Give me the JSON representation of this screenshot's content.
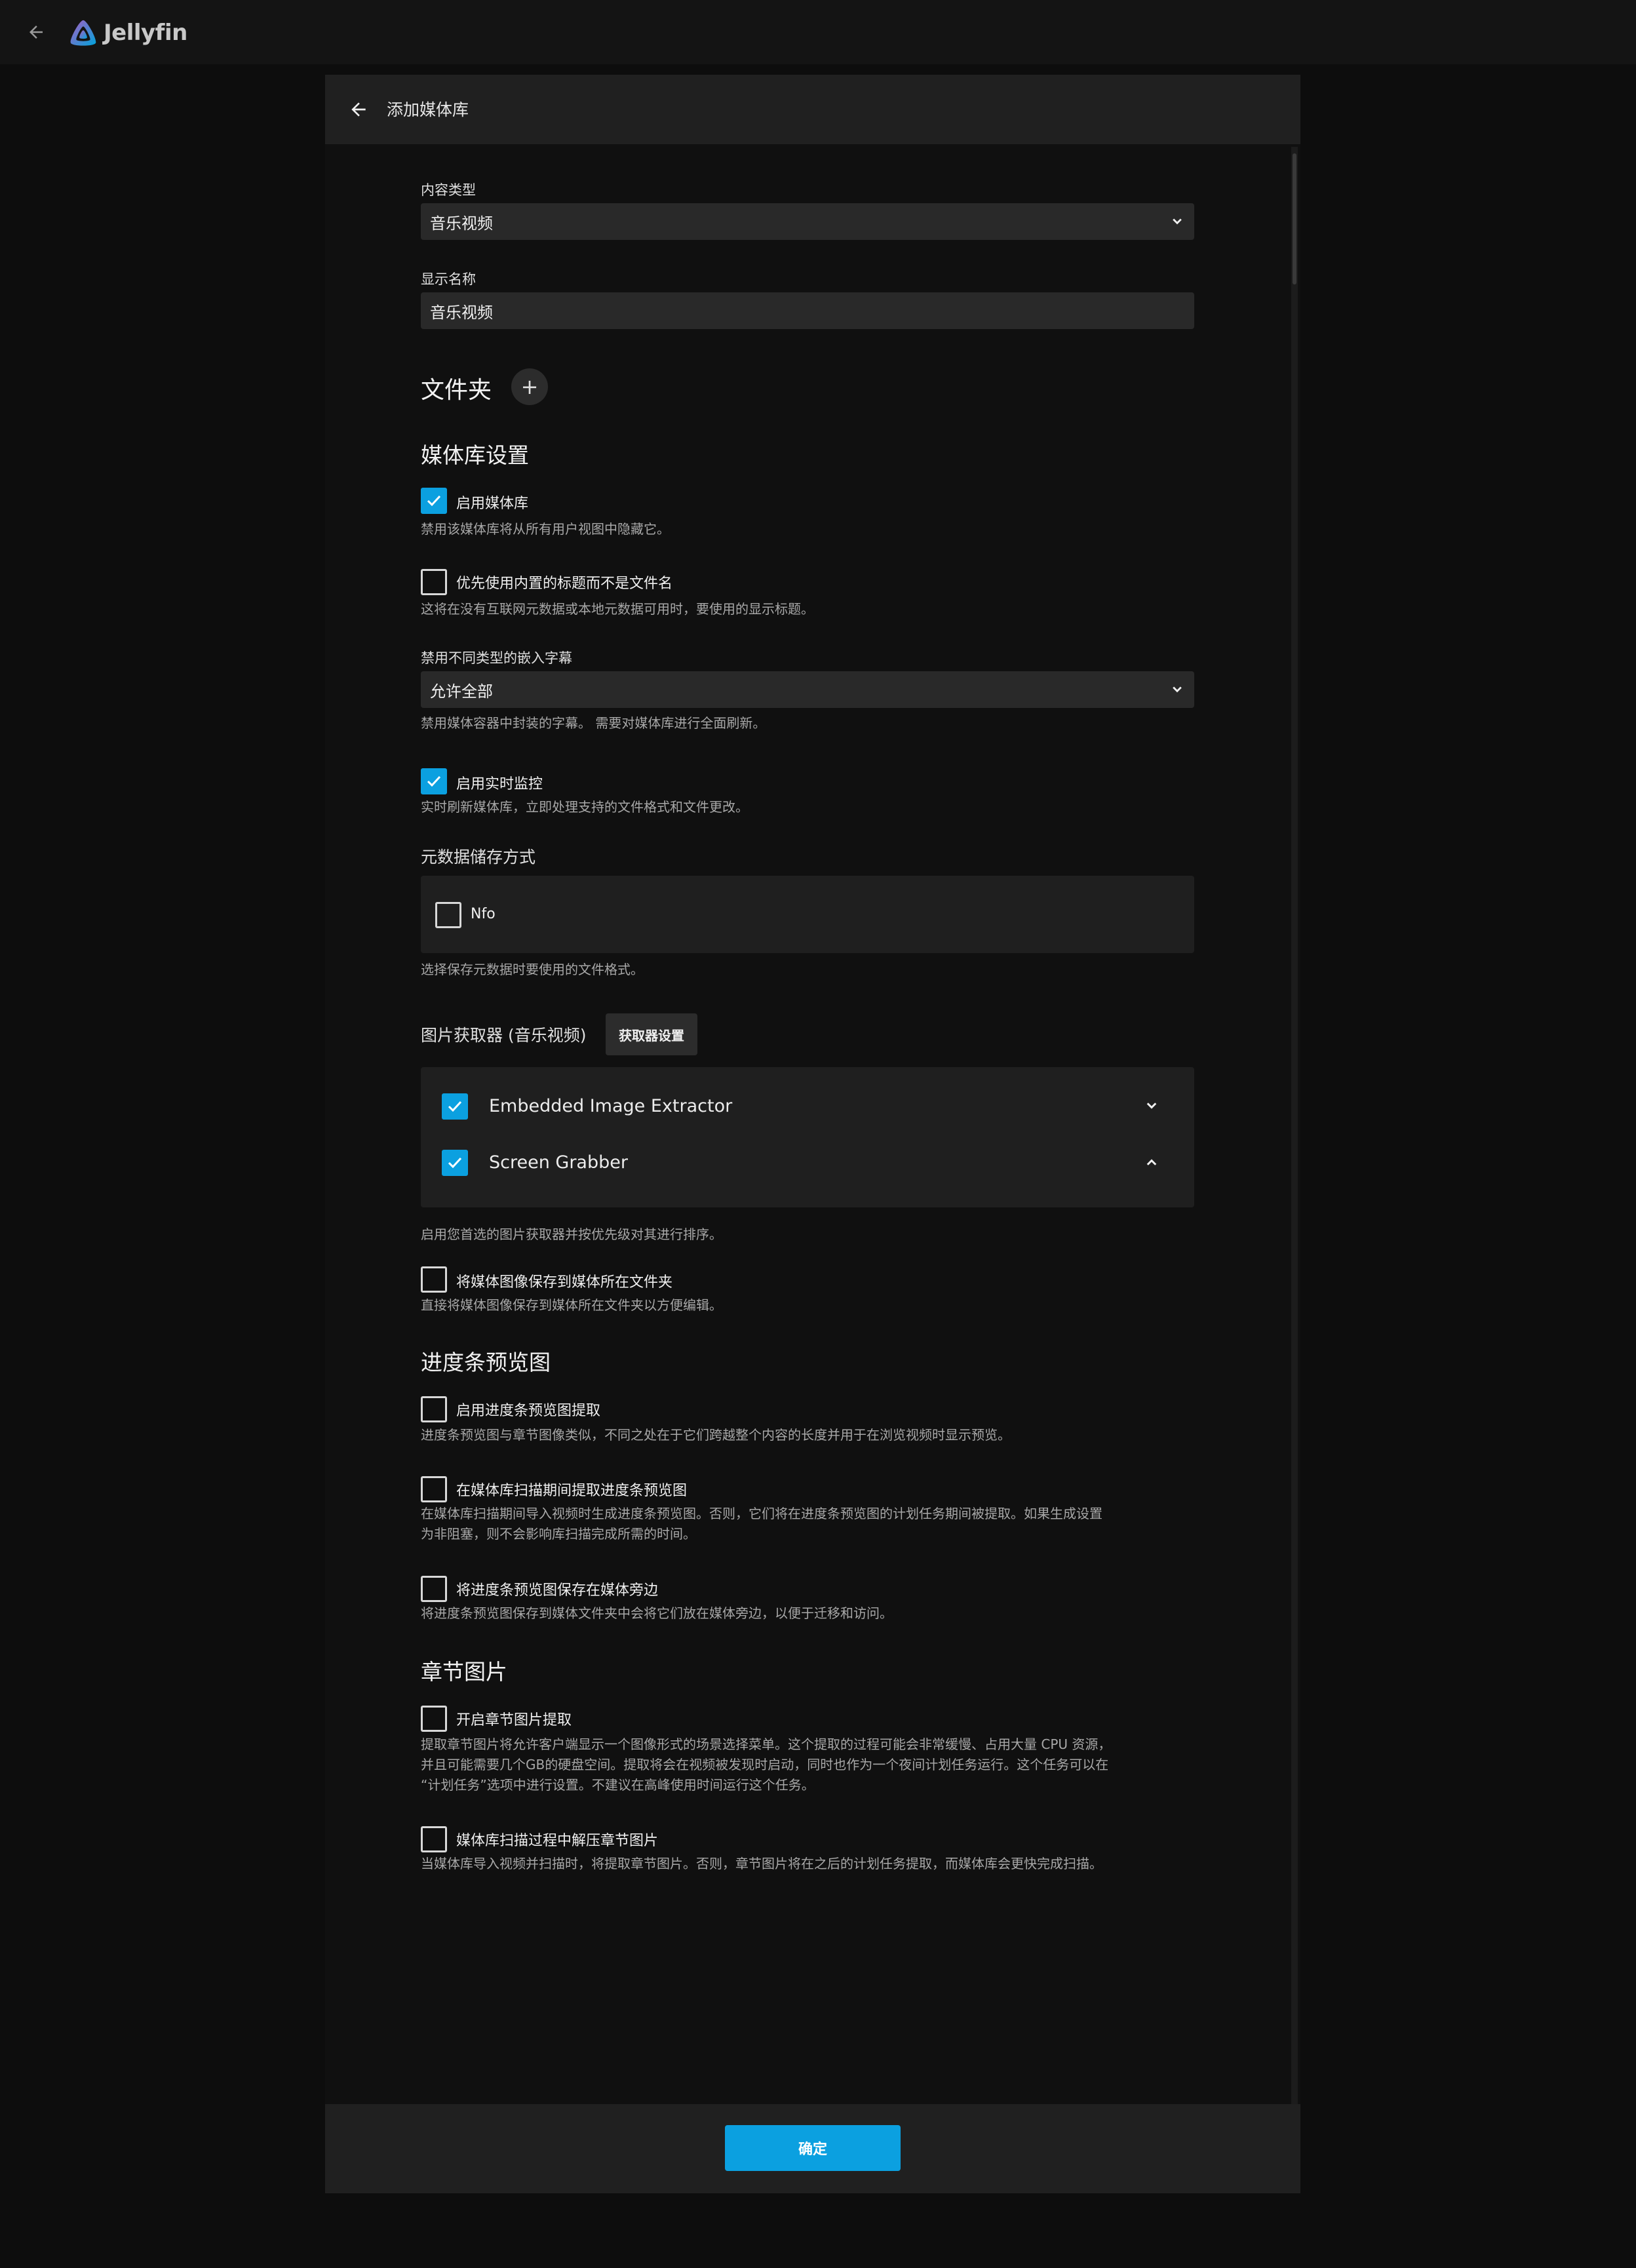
{
  "app": {
    "name": "Jellyfin",
    "accent_color": "#0ba0e0"
  },
  "dialog": {
    "title": "添加媒体库",
    "content_type": {
      "label": "内容类型",
      "value": "音乐视频"
    },
    "display_name": {
      "label": "显示名称",
      "value": "音乐视频"
    },
    "folders": {
      "heading": "文件夹",
      "add_icon": "plus-icon"
    },
    "library_settings": {
      "heading": "媒体库设置",
      "enable_library": {
        "label": "启用媒体库",
        "checked": true,
        "help": "禁用该媒体库将从所有用户视图中隐藏它。"
      },
      "prefer_embedded_titles": {
        "label": "优先使用内置的标题而不是文件名",
        "checked": false,
        "help": "这将在没有互联网元数据或本地元数据可用时，要使用的显示标题。"
      },
      "disable_subtitles": {
        "label": "禁用不同类型的嵌入字幕",
        "value": "允许全部",
        "help": "禁用媒体容器中封装的字幕。 需要对媒体库进行全面刷新。"
      },
      "realtime_monitor": {
        "label": "启用实时监控",
        "checked": true,
        "help": "实时刷新媒体库，立即处理支持的文件格式和文件更改。"
      },
      "metadata_savers": {
        "label": "元数据储存方式",
        "nfo_label": "Nfo",
        "nfo_checked": false,
        "help": "选择保存元数据时要使用的文件格式。"
      },
      "image_fetchers": {
        "label": "图片获取器 (音乐视频)",
        "settings_button": "获取器设置",
        "items": [
          {
            "label": "Embedded Image Extractor",
            "checked": true,
            "chevron": "chevron-down-icon"
          },
          {
            "label": "Screen Grabber",
            "checked": true,
            "chevron": "chevron-up-icon"
          }
        ],
        "help": "启用您首选的图片获取器并按优先级对其进行排序。"
      },
      "save_local_images": {
        "label": "将媒体图像保存到媒体所在文件夹",
        "checked": false,
        "help": "直接将媒体图像保存到媒体所在文件夹以方便编辑。"
      }
    },
    "trickplay": {
      "heading": "进度条预览图",
      "enable": {
        "label": "启用进度条预览图提取",
        "checked": false,
        "help": "进度条预览图与章节图像类似，不同之处在于它们跨越整个内容的长度并用于在浏览视频时显示预览。"
      },
      "during_scan": {
        "label": "在媒体库扫描期间提取进度条预览图",
        "checked": false,
        "help_line1": "在媒体库扫描期间导入视频时生成进度条预览图。否则，它们将在进度条预览图的计划任务期间被提取。如果生成设置",
        "help_line2": "为非阻塞，则不会影响库扫描完成所需的时间。"
      },
      "save_local": {
        "label": "将进度条预览图保存在媒体旁边",
        "checked": false,
        "help": "将进度条预览图保存到媒体文件夹中会将它们放在媒体旁边，以便于迁移和访问。"
      }
    },
    "chapter_images": {
      "heading": "章节图片",
      "enable": {
        "label": "开启章节图片提取",
        "checked": false,
        "help_line1": "提取章节图片将允许客户端显示一个图像形式的场景选择菜单。这个提取的过程可能会非常缓慢、占用大量 CPU 资源，",
        "help_line2": "并且可能需要几个GB的硬盘空间。提取将会在视频被发现时启动，同时也作为一个夜间计划任务运行。这个任务可以在",
        "help_line3": "“计划任务”选项中进行设置。不建议在高峰使用时间运行这个任务。"
      },
      "during_scan": {
        "label": "媒体库扫描过程中解压章节图片",
        "checked": false,
        "help": "当媒体库导入视频并扫描时，将提取章节图片。否则，章节图片将在之后的计划任务提取，而媒体库会更快完成扫描。"
      }
    },
    "ok_button": "确定"
  }
}
